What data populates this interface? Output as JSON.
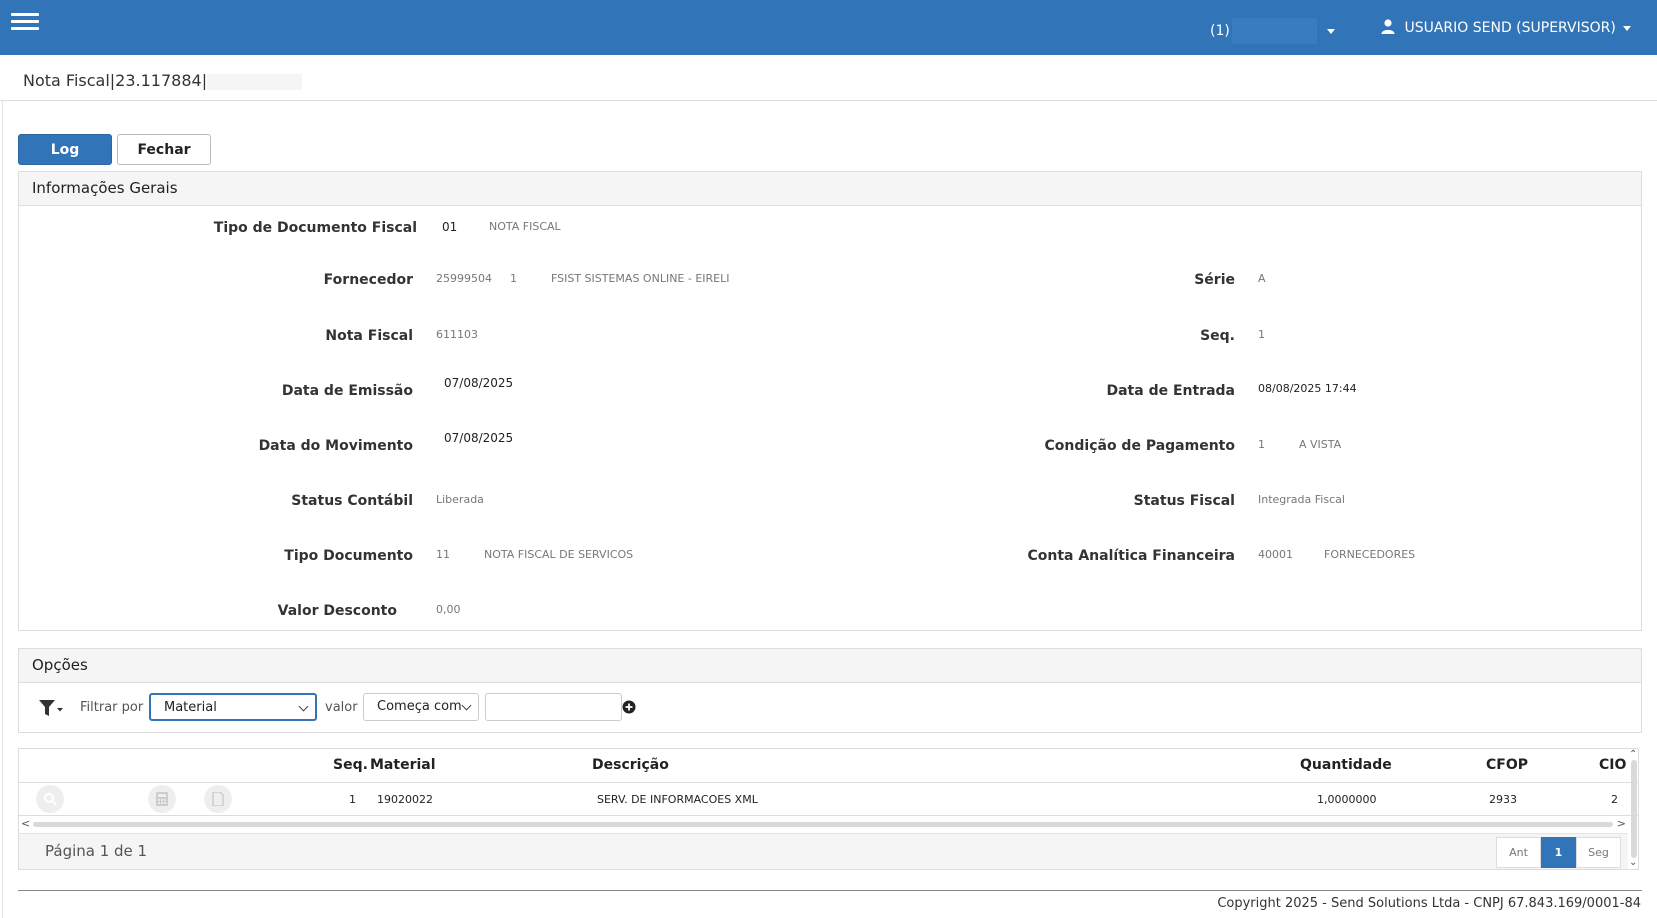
{
  "header": {
    "company_prefix": "(1)",
    "user_label": "USUARIO SEND (SUPERVISOR)"
  },
  "page": {
    "title": "Nota Fiscal|23.117884|"
  },
  "toolbar": {
    "log": "Log",
    "fechar": "Fechar"
  },
  "info": {
    "heading": "Informações Gerais",
    "tipo_doc_fiscal": {
      "label": "Tipo de Documento Fiscal",
      "code": "01",
      "desc": "NOTA FISCAL"
    },
    "fornecedor": {
      "label": "Fornecedor",
      "code": "25999504",
      "seq": "1",
      "name": "FSIST SISTEMAS ONLINE - EIRELI"
    },
    "serie": {
      "label": "Série",
      "value": "A"
    },
    "nota_fiscal": {
      "label": "Nota Fiscal",
      "value": "611103"
    },
    "seq": {
      "label": "Seq.",
      "value": "1"
    },
    "data_emissao": {
      "label": "Data de Emissão",
      "value": "07/08/2025"
    },
    "data_entrada": {
      "label": "Data de Entrada",
      "value": "08/08/2025 17:44"
    },
    "data_movimento": {
      "label": "Data do Movimento",
      "value": "07/08/2025"
    },
    "condicao_pagamento": {
      "label": "Condição de Pagamento",
      "code": "1",
      "desc": "A VISTA"
    },
    "status_contabil": {
      "label": "Status Contábil",
      "value": "Liberada"
    },
    "status_fiscal": {
      "label": "Status Fiscal",
      "value": "Integrada Fiscal"
    },
    "tipo_documento": {
      "label": "Tipo Documento",
      "code": "11",
      "desc": "NOTA FISCAL DE SERVICOS"
    },
    "conta_analitica": {
      "label": "Conta Analítica Financeira",
      "code": "40001",
      "desc": "FORNECEDORES"
    },
    "valor_desconto": {
      "label": "Valor Desconto",
      "value": "0,00"
    }
  },
  "options": {
    "heading": "Opções",
    "filter_label": "Filtrar por",
    "filter_field": "Material",
    "value_label": "valor",
    "operator": "Começa com",
    "search_value": ""
  },
  "grid": {
    "headers": {
      "seq": "Seq.",
      "material": "Material",
      "descricao": "Descrição",
      "quantidade": "Quantidade",
      "cfop": "CFOP",
      "cio": "CIO"
    },
    "rows": [
      {
        "seq": "1",
        "material": "19020022",
        "descricao": "SERV. DE INFORMACOES XML",
        "quantidade": "1,0000000",
        "cfop": "2933",
        "cio": "2"
      }
    ]
  },
  "pager": {
    "info": "Página 1 de 1",
    "prev": "Ant",
    "current": "1",
    "next": "Seg"
  },
  "footer": {
    "copyright": "Copyright 2025 - Send Solutions Ltda - CNPJ 67.843.169/0001-84"
  },
  "colors": {
    "primary": "#3174b7",
    "panel_header": "#f5f5f5"
  }
}
